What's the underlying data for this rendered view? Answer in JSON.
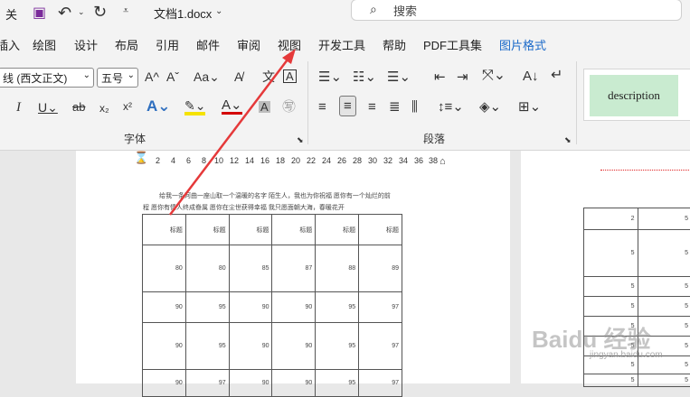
{
  "titlebar": {
    "doc_title": "文档1.docx",
    "left_cut": "关",
    "search_placeholder": "搜索"
  },
  "menus": [
    "插入",
    "绘图",
    "设计",
    "布局",
    "引用",
    "邮件",
    "审阅",
    "视图",
    "开发工具",
    "帮助",
    "PDF工具集",
    "图片格式"
  ],
  "menu_first_visible": "插入",
  "ribbon": {
    "font_name": "线 (西文正文)",
    "font_size": "五号",
    "font_group_label": "字体",
    "para_group_label": "段落",
    "style_name": "description"
  },
  "ruler_numbers": [
    "2",
    "4",
    "6",
    "8",
    "10",
    "12",
    "14",
    "16",
    "18",
    "20",
    "22",
    "24",
    "26",
    "28",
    "30",
    "32",
    "34",
    "36",
    "38"
  ],
  "doc_text": {
    "line1": "给我一条河曲一座山取一个温暖的名字 陌生人，我也为你祝福 愿你有一个灿烂的前",
    "line2": "程 愿你有情人终成眷属 愿你在尘世获得幸福 我只愿面朝大海，春暖花开"
  },
  "table": {
    "headers": [
      "标题",
      "标题",
      "标题",
      "标题",
      "标题",
      "标题"
    ],
    "rows": [
      [
        "80",
        "80",
        "85",
        "87",
        "88",
        "89"
      ],
      [
        "90",
        "95",
        "90",
        "90",
        "95",
        "97"
      ],
      [
        "90",
        "95",
        "90",
        "90",
        "95",
        "97"
      ],
      [
        "90",
        "97",
        "90",
        "90",
        "95",
        "97"
      ]
    ]
  },
  "right_table": {
    "rows": [
      [
        "2",
        "5"
      ],
      [
        "5",
        "5"
      ],
      [
        "5",
        "5"
      ],
      [
        "5",
        "5"
      ],
      [
        "5",
        "5"
      ],
      [
        "5",
        "5"
      ],
      [
        "5",
        "5"
      ],
      [
        "5",
        "5"
      ]
    ]
  },
  "watermark": {
    "brand": "Baidu 经验",
    "url": "jingyan.baidu.com"
  },
  "colors": {
    "accent_menu": "#1b6ac9",
    "arrow": "#e5393a",
    "style_bg": "#c9ebd0"
  },
  "icons": [
    "save-icon",
    "undo-icon",
    "redo-icon",
    "search-icon",
    "font-color-icon",
    "highlight-icon",
    "bullet-list-icon",
    "align-center-icon"
  ]
}
